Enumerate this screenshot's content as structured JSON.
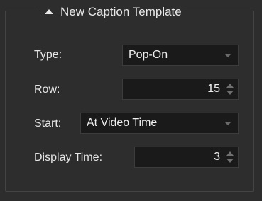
{
  "panel": {
    "title": "New Caption Template"
  },
  "fields": {
    "type": {
      "label": "Type:",
      "value": "Pop-On"
    },
    "row": {
      "label": "Row:",
      "value": "15"
    },
    "start": {
      "label": "Start:",
      "value": "At Video Time"
    },
    "display_time": {
      "label": "Display Time:",
      "value": "3"
    }
  },
  "icons": {
    "collapse": "triangle-up-icon",
    "dropdown": "chevron-down-icon",
    "spinner": "spinner-arrows-icon"
  },
  "colors": {
    "panel_background": "#2d2d2d",
    "field_background": "#1a1a1a",
    "text": "#e6e6e6"
  }
}
